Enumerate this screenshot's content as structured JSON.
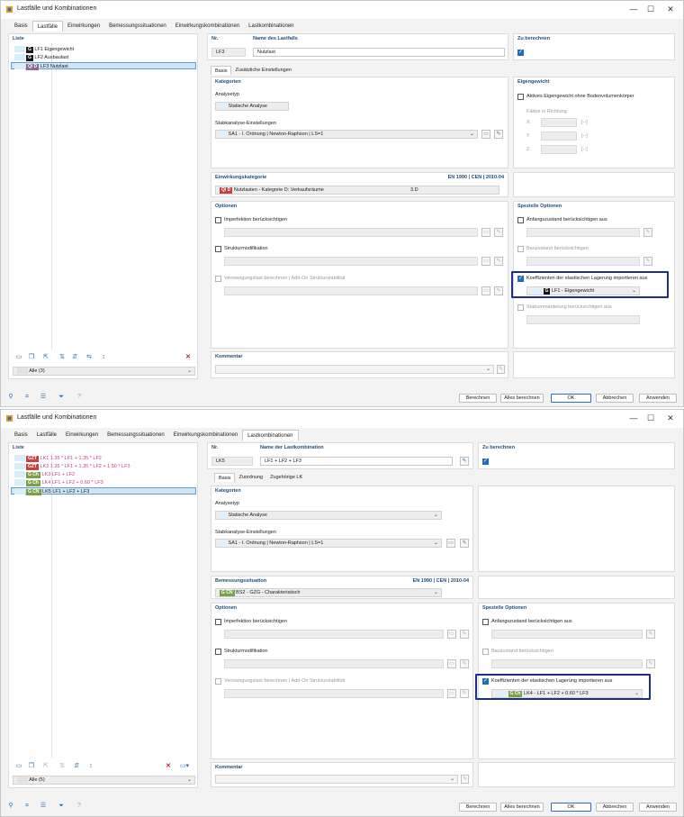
{
  "dialog_title": "Lastfälle und Kombinationen",
  "main_tabs": [
    "Basis",
    "Lastfälle",
    "Einwirkungen",
    "Bemessungssituationen",
    "Einwirkungskombinationen",
    "Lastkombinationen"
  ],
  "window_controls": {
    "minimize": "—",
    "maximize": "☐",
    "close": "✕"
  },
  "common": {
    "liste": "Liste",
    "nr": "Nr.",
    "zu_berechnen": "Zu berechnen",
    "basis": "Basis",
    "kategorien": "Kategorien",
    "analysetyp": "Analysetyp",
    "analysetyp_value": "Statische Analyse",
    "stabkanalyse": "Stabkanalyse-Einstellungen",
    "stabkanalyse_value": "SA1 - I. Ordnung | Newton-Raphson | LS=1",
    "norm": "EN 1990 | CEN | 2010-04",
    "optionen": "Optionen",
    "imperfektion": "Imperfektion berücksichtigen",
    "strukturmod": "Strukturmodifikation",
    "verzweigung": "Verzweigungslast berechnen | Add-On Strukturstabilität",
    "spezielle": "Spezielle Optionen",
    "anfangszustand": "Anfangszustand berücksichtigen aus",
    "bauzustand": "Bauzustand berücksichtigen",
    "koeffizienten": "Koeffizienten der elastischen Lagerung importieren aus",
    "kommentar": "Kommentar",
    "buttons": {
      "berechnen": "Berechnen",
      "alles": "Alles berechnen",
      "ok": "OK",
      "abbrechen": "Abbrechen",
      "anwenden": "Anwenden"
    }
  },
  "top": {
    "active_tab": "Lastfälle",
    "list": [
      {
        "tag": "G",
        "tag_color": "black",
        "text": "LF1  Eigengewicht"
      },
      {
        "tag": "G",
        "tag_color": "black",
        "text": "LF2  Ausbaulast"
      },
      {
        "tag": "Qi D",
        "tag_color": "purple",
        "text": "LF3  Nutzlast"
      }
    ],
    "filter": "Alle (3)",
    "nr_value": "LF3",
    "name_label": "Name des Lastfalls",
    "name_value": "Nutzlast",
    "subtabs": [
      "Basis",
      "Zusätzliche Einstellungen"
    ],
    "eigengewicht": "Eigengewicht",
    "aktives_eg": "Aktives Eigengewicht ohne Bodenvolumenkörper",
    "faktor": "Faktor in Richtung",
    "axes": [
      "X",
      "Y",
      "Z"
    ],
    "unit": "[--]",
    "einwirkungskat": "Einwirkungskategorie",
    "kat_tag": "Qi D",
    "kat_value": "Nutzlasten - Kategorie D: Verkaufsräume",
    "kat_code": "3.D",
    "stabummantelung": "Stabummantelung berücksichtigen aus",
    "koeff_tag": "G",
    "koeff_value": "LF1 - Eigengewicht"
  },
  "bottom": {
    "active_tab": "Lastkombinationen",
    "list": [
      {
        "tag": "GZT",
        "tag_color": "red",
        "text": "LK1  1.35 * LF1 + 1.35 * LF2",
        "color": "#c23c8c"
      },
      {
        "tag": "GZT",
        "tag_color": "red",
        "text": "LK2  1.35 * LF1 + 1.35 * LF2 + 1.50 * LF3",
        "color": "#c23c8c"
      },
      {
        "tag": "G Ch",
        "tag_color": "green",
        "text": "LK3  LF1 + LF2",
        "color": "#c23c8c"
      },
      {
        "tag": "G Ch",
        "tag_color": "green",
        "text": "LK4  LF1 + LF2 + 0.60 * LF3",
        "color": "#c23c8c"
      },
      {
        "tag": "G CN",
        "tag_color": "green",
        "text": "LK5  LF1 + LF2 + LF3",
        "color": "#1a1a1a"
      }
    ],
    "filter": "Alle (5)",
    "nr_value": "LK5",
    "name_label": "Name der Lastkombination",
    "name_value": "LF1 + LF2 + LF3",
    "subtabs": [
      "Basis",
      "Zuordnung",
      "Zugehörige LK"
    ],
    "bemessungssit": "Bemessungssituation",
    "bs_tag": "G CN",
    "bs_value": "BS2 - GZG - Charakteristisch",
    "koeff_tag": "G Ch",
    "koeff_value": "LK4 - LF1 + LF2 + 0.60 * LF3"
  }
}
